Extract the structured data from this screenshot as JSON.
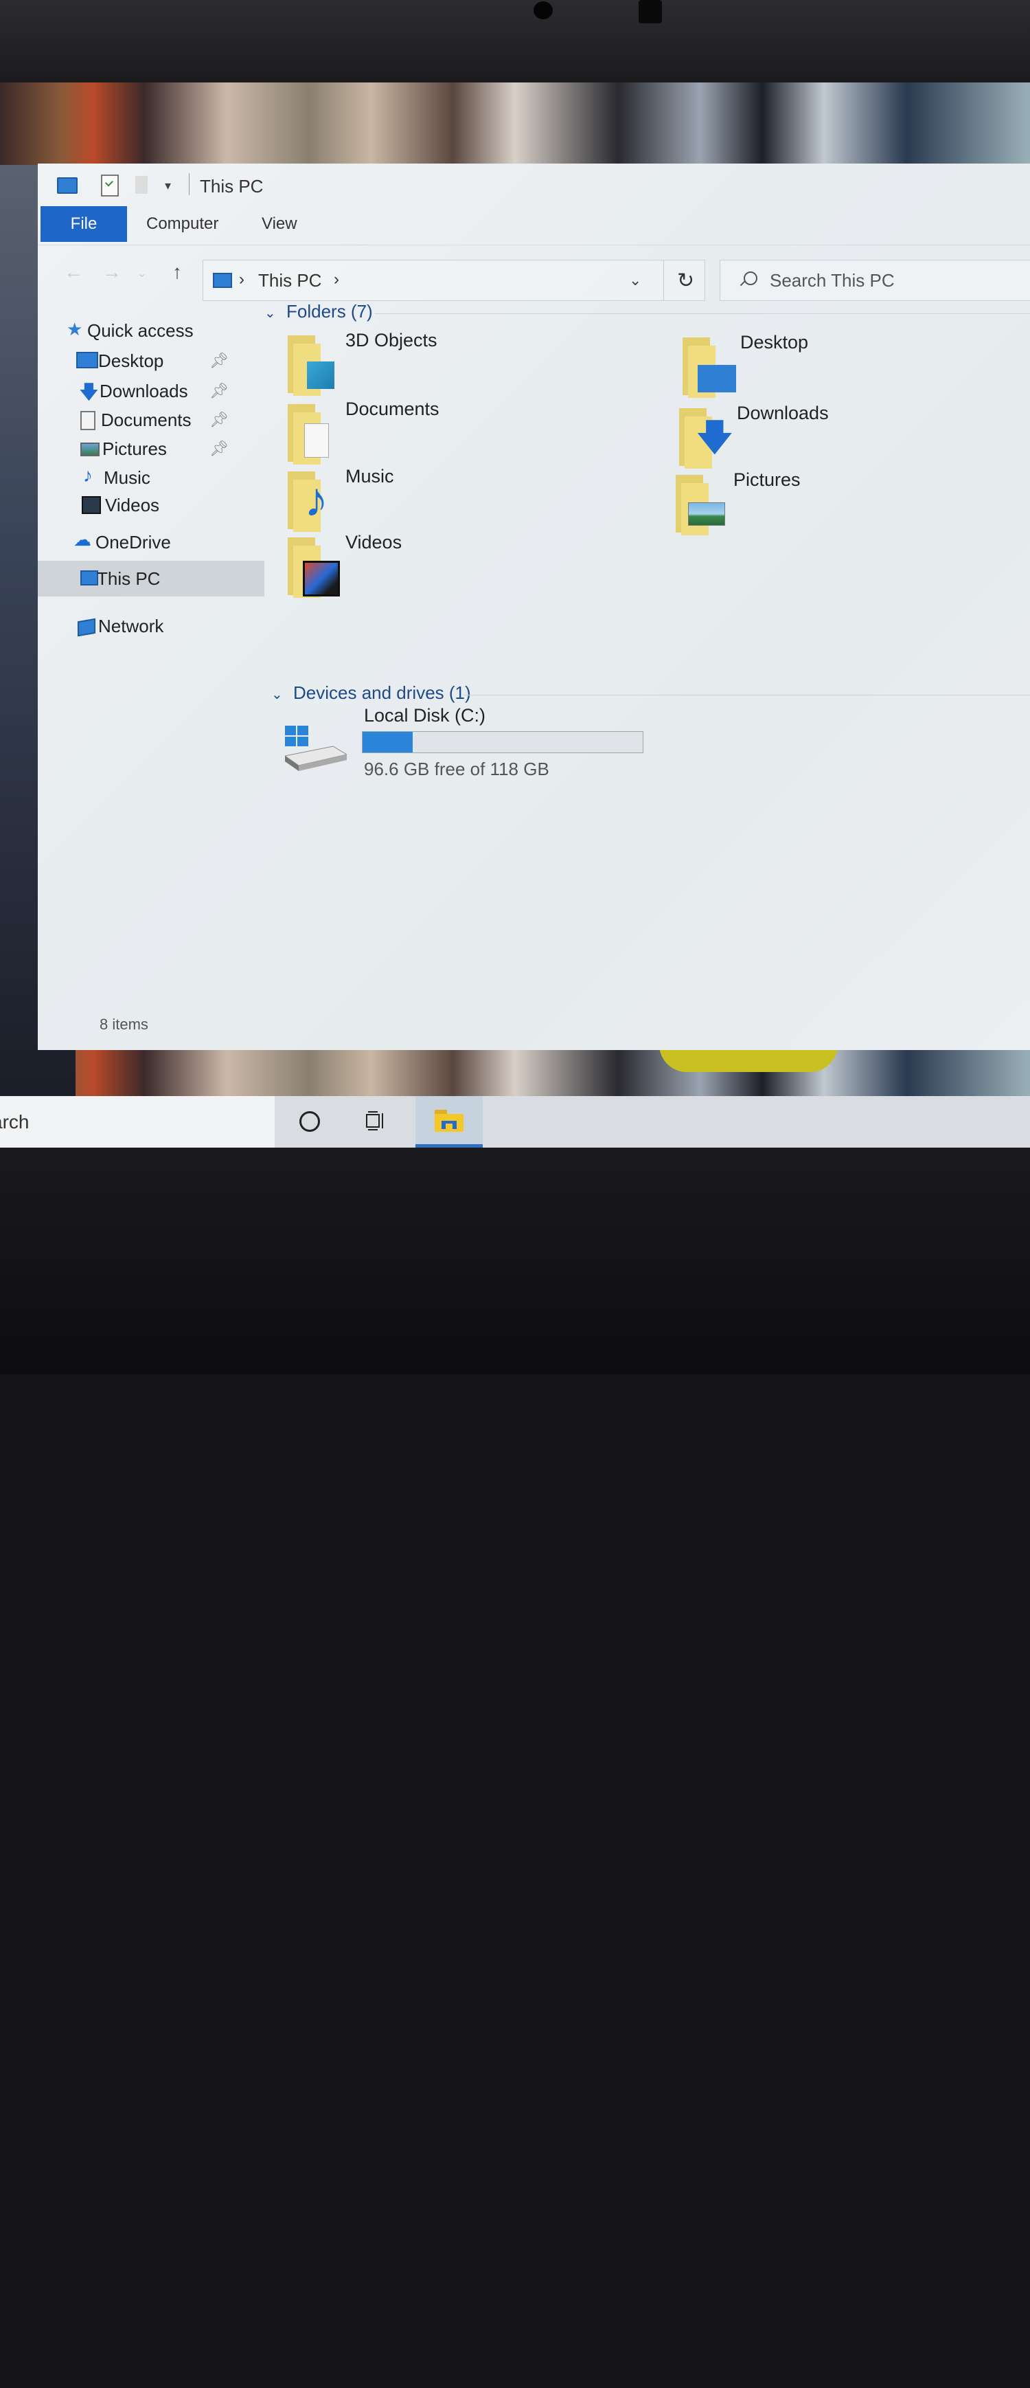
{
  "titlebar": {
    "title": "This PC"
  },
  "ribbon": {
    "tabs": [
      "File",
      "Computer",
      "View"
    ],
    "active_color": "#1f66c9"
  },
  "navigation": {
    "address_segment": "This PC",
    "search_placeholder": "Search This PC"
  },
  "sidebar": {
    "items": [
      {
        "label": "Quick access",
        "icon": "star-icon"
      },
      {
        "label": "Desktop",
        "icon": "desktop-icon",
        "pinned": true
      },
      {
        "label": "Downloads",
        "icon": "download-arrow-icon",
        "pinned": true
      },
      {
        "label": "Documents",
        "icon": "document-icon",
        "pinned": true
      },
      {
        "label": "Pictures",
        "icon": "picture-icon",
        "pinned": true
      },
      {
        "label": "Music",
        "icon": "music-note-icon"
      },
      {
        "label": "Videos",
        "icon": "film-icon"
      },
      {
        "label": "OneDrive",
        "icon": "cloud-icon"
      },
      {
        "label": "This PC",
        "icon": "computer-icon",
        "selected": true
      },
      {
        "label": "Network",
        "icon": "network-icon"
      }
    ]
  },
  "content": {
    "folders_header": "Folders (7)",
    "folders": [
      {
        "label": "3D Objects",
        "overlay": "cube-icon"
      },
      {
        "label": "Desktop",
        "overlay": "desktop-icon"
      },
      {
        "label": "Documents",
        "overlay": "document-icon"
      },
      {
        "label": "Downloads",
        "overlay": "download-arrow-icon"
      },
      {
        "label": "Music",
        "overlay": "music-note-icon"
      },
      {
        "label": "Pictures",
        "overlay": "landscape-icon"
      },
      {
        "label": "Videos",
        "overlay": "film-icon"
      }
    ],
    "drives_header": "Devices and drives (1)",
    "drive": {
      "label": "Local Disk (C:)",
      "free_text": "96.6 GB free of 118 GB",
      "used_fraction": 0.18,
      "bar_color": "#2a85d8"
    }
  },
  "status": {
    "items_count": "8 items"
  },
  "taskbar": {
    "search_fragment": "arch"
  }
}
